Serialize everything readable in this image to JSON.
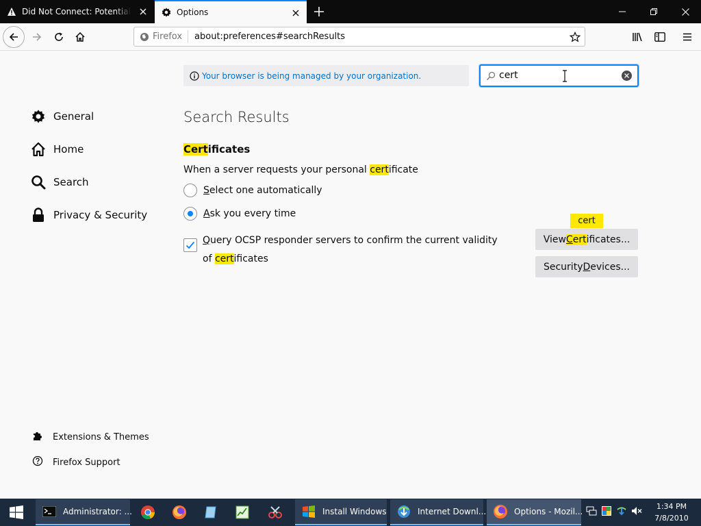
{
  "tabs": [
    {
      "title": "Did Not Connect: Potential Security Issue",
      "icon": "warning-icon"
    },
    {
      "title": "Options",
      "icon": "gear-icon"
    }
  ],
  "toolbar": {
    "identity_label": "Firefox",
    "url": "about:preferences#searchResults"
  },
  "policy": {
    "text": "Your browser is being managed by your organization."
  },
  "search": {
    "value": "cert"
  },
  "categories": [
    {
      "label": "General",
      "icon": "gear-icon"
    },
    {
      "label": "Home",
      "icon": "home-icon"
    },
    {
      "label": "Search",
      "icon": "search-icon"
    },
    {
      "label": "Privacy & Security",
      "icon": "lock-icon"
    }
  ],
  "footer_links": [
    {
      "label": "Extensions & Themes",
      "icon": "puzzle-icon"
    },
    {
      "label": "Firefox Support",
      "icon": "help-icon"
    }
  ],
  "results": {
    "title": "Search Results",
    "group": {
      "hl": "Cert",
      "rest": "ificates"
    },
    "desc": {
      "pre": "When a server requests your personal ",
      "hl": "cert",
      "post": "ificate"
    },
    "radio1": {
      "underline": "S",
      "rest": "elect one automatically",
      "checked": false
    },
    "radio2": {
      "underline": "A",
      "rest": "sk you every time",
      "checked": true
    },
    "ocsp": {
      "underline": "Q",
      "rest": "uery OCSP responder servers to confirm the current validity of ",
      "hl": "cert",
      "post": "ificates",
      "checked": true
    },
    "view_btn": {
      "pre": "View ",
      "hl_u": "C",
      "hl": "ert",
      "post": "ificates..."
    },
    "devices_btn": {
      "pre": "Security ",
      "u": "D",
      "post": "evices..."
    },
    "tooltip": "cert"
  },
  "taskbar": {
    "items": [
      {
        "label": "Administrator: ...",
        "icon": "cmd-icon"
      },
      {
        "label": "Install Windows",
        "icon": "windows-setup-icon"
      },
      {
        "label": "Internet Downl...",
        "icon": "idm-icon"
      },
      {
        "label": "Options - Mozil...",
        "icon": "firefox-icon"
      }
    ],
    "time": "1:34 PM",
    "date": "7/8/2010"
  },
  "colors": {
    "accent": "#0a84ff",
    "highlight": "#ffe900",
    "taskbar": "#1c2a3d"
  }
}
